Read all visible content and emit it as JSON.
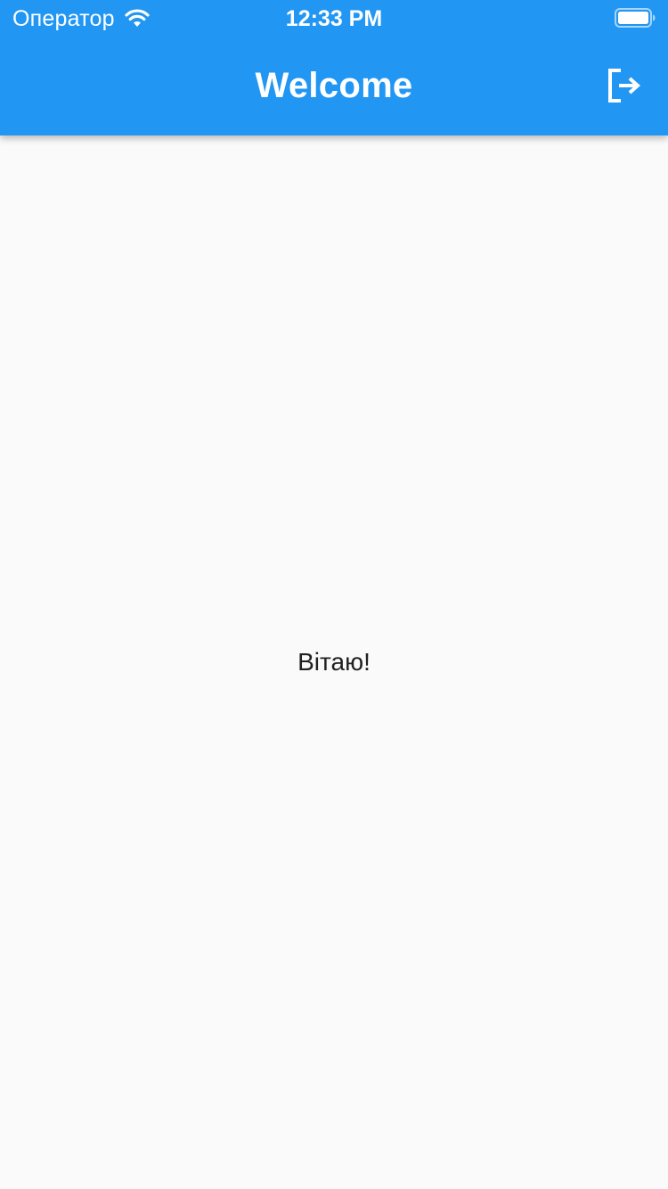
{
  "status_bar": {
    "carrier": "Оператор",
    "time": "12:33 PM",
    "icons": [
      "wifi-icon",
      "battery-icon"
    ]
  },
  "app_bar": {
    "title": "Welcome",
    "action_icon": "logout-icon"
  },
  "main": {
    "greeting": "Вітаю!"
  },
  "colors": {
    "app_bar": "#2196F3",
    "background": "#FAFAFA",
    "text": "#212121",
    "on_primary": "#FFFFFF"
  }
}
